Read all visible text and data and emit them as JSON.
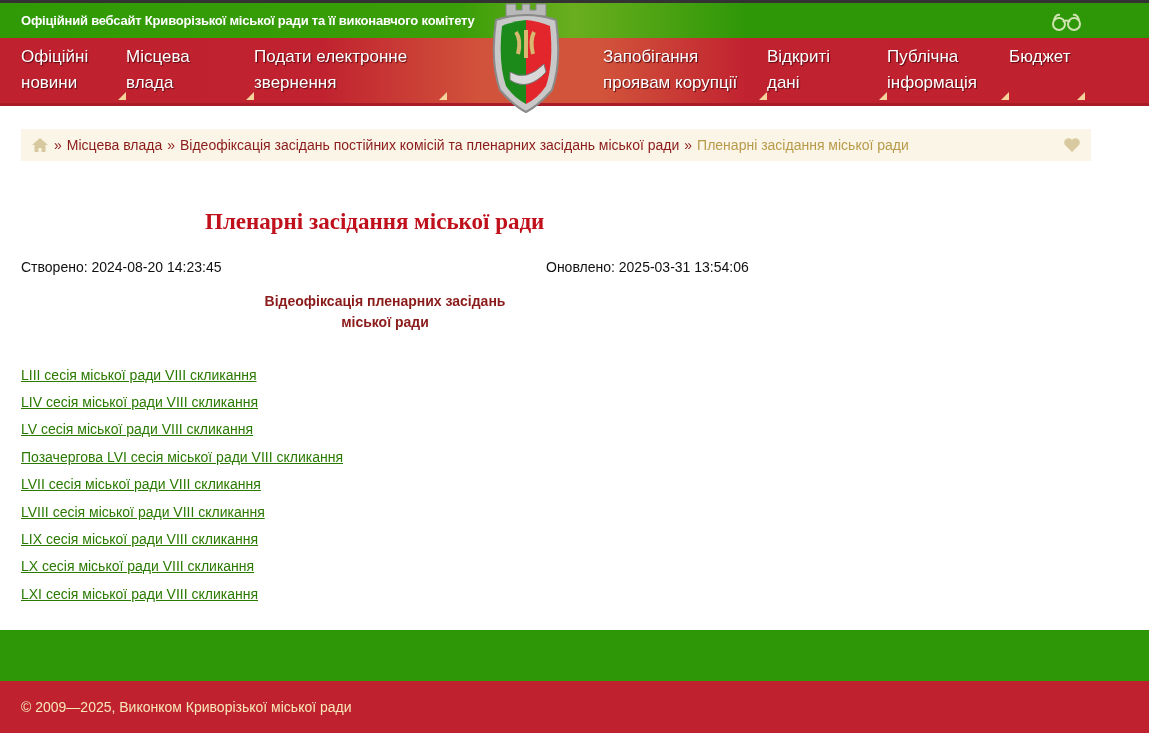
{
  "site_title": "Офіційний вебсайт Криворізької міської ради та її виконавчого комітету",
  "nav_left": [
    {
      "label": "Офіційні новини"
    },
    {
      "label": "Місцева влада"
    },
    {
      "label": "Подати електронне звернення"
    }
  ],
  "nav_right": [
    {
      "label": "Запобігання проявам корупції"
    },
    {
      "label": "Відкриті дані"
    },
    {
      "label": "Публічна інформація"
    },
    {
      "label": "Бюджет"
    }
  ],
  "breadcrumb": [
    {
      "separator": "»",
      "label": "Місцева влада",
      "current": false
    },
    {
      "separator": "»",
      "label": "Відеофіксація засідань постійних комісій та пленарних засідань міської ради",
      "current": false
    },
    {
      "separator": "»",
      "label": "Пленарні засідання міської ради",
      "current": true
    }
  ],
  "page_title": "Пленарні засідання міської ради",
  "created": "Створено: 2024-08-20 14:23:45",
  "updated": "Оновлено: 2025-03-31 13:54:06",
  "subheading": "Відеофіксація пленарних засідань міської ради",
  "links": [
    "LIII сесія міської ради VIII скликання",
    "LIV сесія міської ради VIII скликання",
    "LV сесія міської ради VIII скликання",
    "Позачергова LVI сесія міської ради VIII скликання",
    "LVII сесія міської ради VIII скликання",
    "LVIII сесія міської ради VIII скликання",
    "LIX сесія міської ради VIII скликання",
    "LX сесія міської ради VIII скликання",
    "LXI сесія міської ради VIII скликання"
  ],
  "footer": "© 2009—2025, Виконком Криворізької міської ради"
}
